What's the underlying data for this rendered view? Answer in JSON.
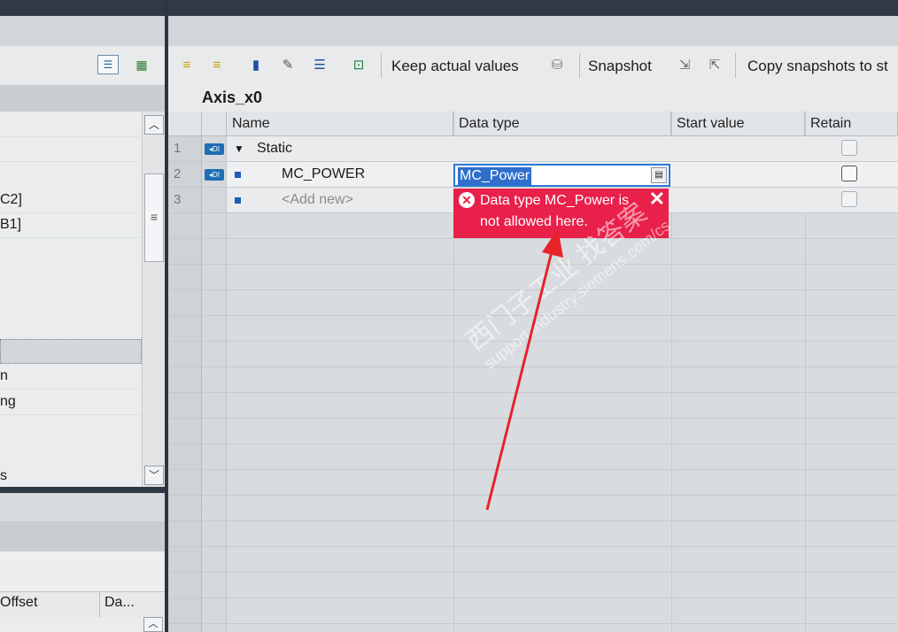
{
  "left_panel": {
    "tree_items": [
      "",
      "",
      "C2]",
      "B1]",
      "",
      "",
      "",
      "",
      "",
      "n",
      "ng",
      "",
      "",
      "s"
    ],
    "columns": {
      "offset": "Offset",
      "data": "Da..."
    }
  },
  "toolbar": {
    "keep_actual_values": "Keep actual values",
    "snapshot": "Snapshot",
    "copy_snapshots": "Copy snapshots to st"
  },
  "block": {
    "title": "Axis_x0"
  },
  "table": {
    "headers": {
      "name": "Name",
      "data_type": "Data type",
      "start_value": "Start value",
      "retain": "Retain"
    },
    "rows": [
      {
        "num": "1",
        "name": "Static",
        "data_type": ""
      },
      {
        "num": "2",
        "name": "MC_POWER",
        "data_type": "MC_Power"
      },
      {
        "num": "3",
        "name": "<Add new>",
        "data_type": ""
      }
    ]
  },
  "error": {
    "message": "Data type MC_Power is not allowed here."
  },
  "watermark": {
    "line1": "西门子工业 找答案",
    "line2": "support.industry.siemens.com/cs"
  },
  "colors": {
    "error": "#e8204a",
    "selection": "#2e6fcc",
    "arrow": "#e8232b"
  }
}
